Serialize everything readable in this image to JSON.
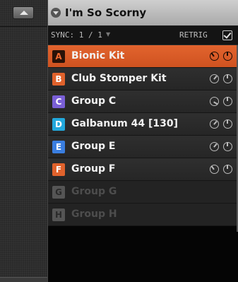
{
  "header": {
    "title": "I'm So Scorny"
  },
  "sync": {
    "label": "SYNC: 1 / 1",
    "dropdown_glyph": "▼",
    "retrig_label": "RETRIG",
    "retrig_checked": true
  },
  "groups": [
    {
      "letter": "A",
      "name": "Bionic Kit",
      "color": "#e0622c",
      "selected": true,
      "empty": false
    },
    {
      "letter": "B",
      "name": "Club Stomper Kit",
      "color": "#e0622c",
      "selected": false,
      "empty": false
    },
    {
      "letter": "C",
      "name": "Group C",
      "color": "#7a5fd6",
      "selected": false,
      "empty": false
    },
    {
      "letter": "D",
      "name": "Galbanum 44 [130]",
      "color": "#22a8dc",
      "selected": false,
      "empty": false
    },
    {
      "letter": "E",
      "name": "Group E",
      "color": "#3a7ee0",
      "selected": false,
      "empty": false
    },
    {
      "letter": "F",
      "name": "Group F",
      "color": "#e0622c",
      "selected": false,
      "empty": false
    },
    {
      "letter": "G",
      "name": "Group G",
      "color": "#555555",
      "selected": false,
      "empty": true
    },
    {
      "letter": "H",
      "name": "Group H",
      "color": "#555555",
      "selected": false,
      "empty": true
    }
  ],
  "icons": {
    "collapse": "triangle-up-icon",
    "header": "chevron-down-icon",
    "knob": "knob-icon",
    "checkbox": "checkmark-icon"
  }
}
